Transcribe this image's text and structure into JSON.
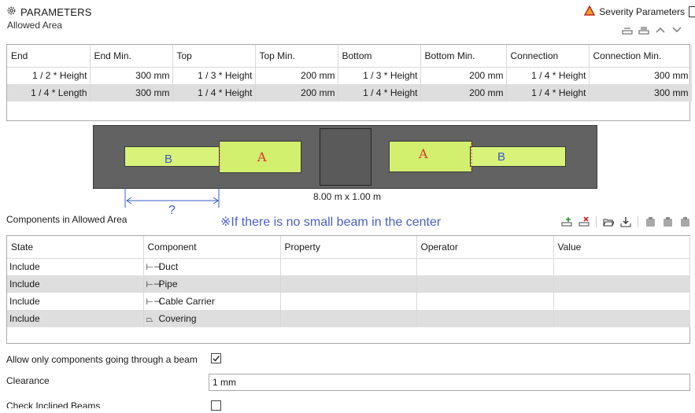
{
  "header": {
    "title": "PARAMETERS",
    "severity_label": "Severity Parameters"
  },
  "allowed_area": {
    "section_label": "Allowed Area",
    "columns": [
      "End",
      "End Min.",
      "Top",
      "Top Min.",
      "Bottom",
      "Bottom Min.",
      "Connection",
      "Connection Min."
    ],
    "rows": [
      [
        "1 / 2 * Height",
        "300 mm",
        "1 / 3 * Height",
        "200 mm",
        "1 / 3 * Height",
        "200 mm",
        "1 / 4 * Height",
        "300 mm"
      ],
      [
        "1 / 4 * Length",
        "300 mm",
        "1 / 4 * Height",
        "200 mm",
        "1 / 4 * Height",
        "200 mm",
        "1 / 4 * Height",
        "300 mm"
      ]
    ]
  },
  "diagram": {
    "left_b": "B",
    "left_a": "A",
    "right_a": "A",
    "right_b": "B",
    "dimension": "8.00 m x 1.00 m",
    "question": "?",
    "note": "※If there is no small beam in the center",
    "colors": {
      "beam_fill": "#d8f27a",
      "frame_fill": "#626262",
      "blue": "#3b5bc4",
      "red": "#dd3333"
    }
  },
  "components": {
    "section_label": "Components in Allowed Area",
    "columns": [
      "State",
      "Component",
      "Property",
      "Operator",
      "Value"
    ],
    "rows": [
      {
        "state": "Include",
        "component": "Duct",
        "icon": "beam-icon"
      },
      {
        "state": "Include",
        "component": "Pipe",
        "icon": "beam-icon"
      },
      {
        "state": "Include",
        "component": "Cable Carrier",
        "icon": "beam-icon"
      },
      {
        "state": "Include",
        "component": "Covering",
        "icon": "covering-icon"
      }
    ]
  },
  "options": {
    "allow_only_label": "Allow only components going through a beam",
    "allow_only_checked": true,
    "clearance_label": "Clearance",
    "clearance_value": "1 mm",
    "check_inclined_label": "Check Inclined Beams",
    "check_inclined_checked": false
  }
}
